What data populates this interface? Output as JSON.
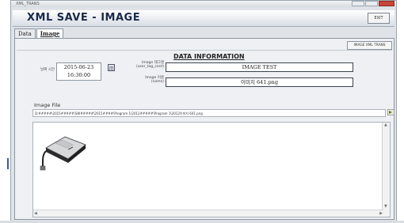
{
  "window": {
    "title": "XML_TRANS"
  },
  "header": {
    "title": "XML SAVE - IMAGE",
    "exit_label": "EXIT"
  },
  "tabs": [
    {
      "label": "Data",
      "active": false
    },
    {
      "label": "Image",
      "active": true
    }
  ],
  "toolbar": {
    "trans_label": "IMAGE XML TRANS"
  },
  "section": {
    "title": "DATA INFORMATION"
  },
  "date_field": {
    "label": "날짜 시간",
    "date": "2015-06-23",
    "time": "16:30:00"
  },
  "image_tag": {
    "label_line1": "Image 태그명",
    "label_line2": "(user_tag_cont)",
    "value": "IMAGE TEST"
  },
  "image_name": {
    "label_line1": "Image 이름",
    "label_line2": "(name)",
    "value": "이미지 641.png"
  },
  "image_file": {
    "label": "Image File",
    "path": "D:#####\\2015#####\\SW#####\\2015####\\Program 1\\2012#####\\Program 1\\2012이미지 641.png"
  },
  "colors": {
    "header_text": "#1a2a4a",
    "accent": "#3a5a9a"
  },
  "icons": {
    "calendar": "calendar-icon",
    "browse": "browse-arrow-icon"
  }
}
